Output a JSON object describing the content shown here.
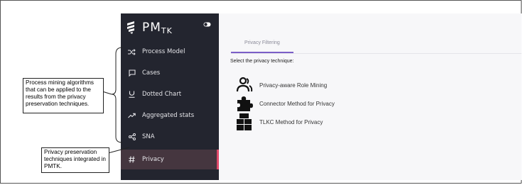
{
  "app": {
    "logo_main": "PM",
    "logo_sub": "TK"
  },
  "sidebar": {
    "items": [
      {
        "label": "Process Model",
        "icon": "shuffle-icon"
      },
      {
        "label": "Cases",
        "icon": "chat-bubble-icon"
      },
      {
        "label": "Dotted Chart",
        "icon": "underline-u-icon"
      },
      {
        "label": "Aggregated stats",
        "icon": "trending-up-icon"
      },
      {
        "label": "SNA",
        "icon": "share-nodes-icon"
      },
      {
        "label": "Privacy",
        "icon": "hash-icon",
        "active": true
      }
    ]
  },
  "main": {
    "tab_label": "Privacy Filtering",
    "prompt": "Select the privacy technique:",
    "techniques": [
      {
        "label": "Privacy-aware Role Mining",
        "icon": "users-icon"
      },
      {
        "label": "Connector Method for Privacy",
        "icon": "puzzle-icon"
      },
      {
        "label": "TLKC Method for Privacy",
        "icon": "blocks-icon"
      }
    ]
  },
  "annotations": {
    "algorithms_note": "Process mining algorithms that can be applied to the results from the privacy preservation techniques.",
    "privacy_note": "Privacy preservation techniques integrated in PMTK."
  },
  "colors": {
    "sidebar_bg": "#23252f",
    "active_bg": "#45363f",
    "accent": "#e04a6a",
    "tab_underline": "#7b5fc7"
  }
}
